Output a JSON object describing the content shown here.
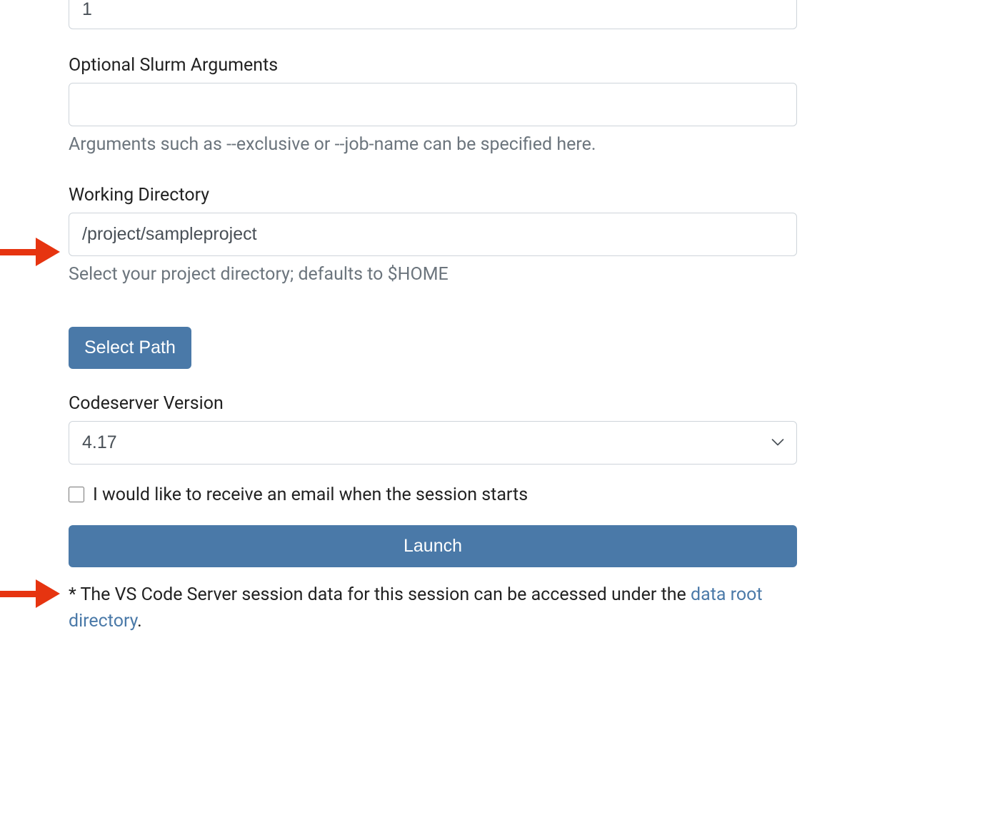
{
  "form": {
    "top_numeric_value": "1",
    "slurm": {
      "label": "Optional Slurm Arguments",
      "value": "",
      "help": "Arguments such as --exclusive or --job-name can be specified here."
    },
    "working_dir": {
      "label": "Working Directory",
      "value": "/project/sampleproject",
      "help": "Select your project directory; defaults to $HOME"
    },
    "select_path_button": "Select Path",
    "codeserver": {
      "label": "Codeserver Version",
      "value": "4.17"
    },
    "email_checkbox": {
      "label": "I would like to receive an email when the session starts",
      "checked": false
    },
    "launch_button": "Launch",
    "footer": {
      "prefix": "* The VS Code Server session data for this session can be accessed under the ",
      "link_text": "data root directory",
      "suffix": "."
    }
  }
}
